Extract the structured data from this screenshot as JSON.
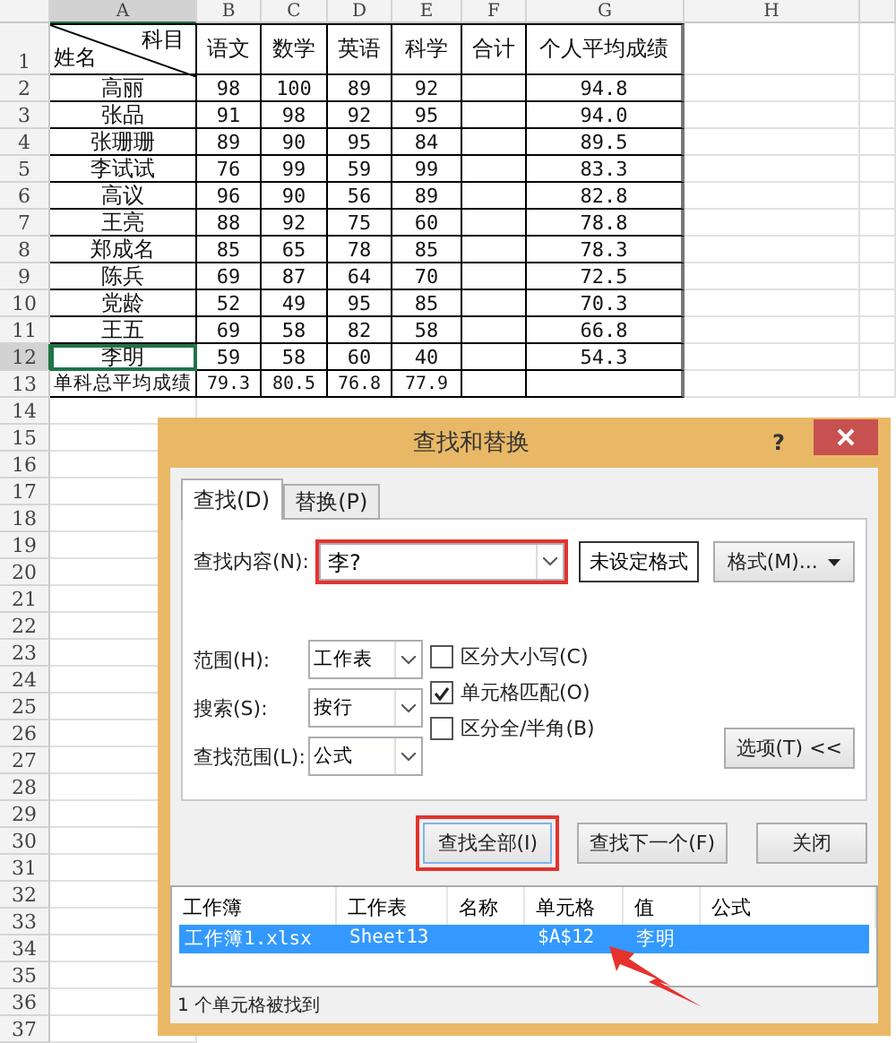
{
  "sheet": {
    "columns": [
      "A",
      "B",
      "C",
      "D",
      "E",
      "F",
      "G",
      "H"
    ],
    "header": {
      "row": "1",
      "subject": "科目",
      "name": "姓名",
      "cells": [
        "语文",
        "数学",
        "英语",
        "科学",
        "合计",
        "个人平均成绩"
      ]
    },
    "rows": [
      {
        "row": "2",
        "name": "高丽",
        "scores": [
          "98",
          "100",
          "89",
          "92"
        ],
        "avg": "94.8",
        "selected": false
      },
      {
        "row": "3",
        "name": "张品",
        "scores": [
          "91",
          "98",
          "92",
          "95"
        ],
        "avg": "94.0",
        "selected": false
      },
      {
        "row": "4",
        "name": "张珊珊",
        "scores": [
          "89",
          "90",
          "95",
          "84"
        ],
        "avg": "89.5",
        "selected": false
      },
      {
        "row": "5",
        "name": "李试试",
        "scores": [
          "76",
          "99",
          "59",
          "99"
        ],
        "avg": "83.3",
        "selected": false
      },
      {
        "row": "6",
        "name": "高议",
        "scores": [
          "96",
          "90",
          "56",
          "89"
        ],
        "avg": "82.8",
        "selected": false
      },
      {
        "row": "7",
        "name": "王亮",
        "scores": [
          "88",
          "92",
          "75",
          "60"
        ],
        "avg": "78.8",
        "selected": false
      },
      {
        "row": "8",
        "name": "郑成名",
        "scores": [
          "85",
          "65",
          "78",
          "85"
        ],
        "avg": "78.3",
        "selected": false
      },
      {
        "row": "9",
        "name": "陈兵",
        "scores": [
          "69",
          "87",
          "64",
          "70"
        ],
        "avg": "72.5",
        "selected": false
      },
      {
        "row": "10",
        "name": "党龄",
        "scores": [
          "52",
          "49",
          "95",
          "85"
        ],
        "avg": "70.3",
        "selected": false
      },
      {
        "row": "11",
        "name": "王五",
        "scores": [
          "69",
          "58",
          "82",
          "58"
        ],
        "avg": "66.8",
        "selected": false
      },
      {
        "row": "12",
        "name": "李明",
        "scores": [
          "59",
          "58",
          "60",
          "40"
        ],
        "avg": "54.3",
        "selected": true
      }
    ],
    "summary": {
      "row": "13",
      "label": "单科总平均成绩",
      "values": [
        "79.3",
        "80.5",
        "76.8",
        "77.9"
      ]
    },
    "more_rows": [
      "14",
      "15",
      "16",
      "17",
      "18",
      "19",
      "20",
      "21",
      "22",
      "23",
      "24",
      "25",
      "26",
      "27",
      "28",
      "29",
      "30",
      "31",
      "32",
      "33",
      "34",
      "35",
      "36",
      "37"
    ]
  },
  "dialog": {
    "title": "查找和替换",
    "help": "?",
    "tabs": [
      {
        "label": "查找(D)",
        "selected": true
      },
      {
        "label": "替换(P)",
        "selected": false
      }
    ],
    "find_what": {
      "label": "查找内容(N):",
      "value": "李?",
      "highlighted": true
    },
    "format_status": "未设定格式",
    "format_button": "格式(M)...",
    "selects": [
      {
        "label": "范围(H):",
        "value": "工作表"
      },
      {
        "label": "搜索(S):",
        "value": "按行"
      },
      {
        "label": "查找范围(L):",
        "value": "公式"
      }
    ],
    "checkboxes": [
      {
        "label": "区分大小写(C)",
        "checked": false
      },
      {
        "label": "单元格匹配(O)",
        "checked": true
      },
      {
        "label": "区分全/半角(B)",
        "checked": false
      }
    ],
    "options_button": "选项(T) <<",
    "buttons": [
      {
        "label": "查找全部(I)",
        "highlighted": true
      },
      {
        "label": "查找下一个(F)",
        "highlighted": false
      },
      {
        "label": "关闭",
        "highlighted": false
      }
    ],
    "results": {
      "columns": [
        "工作簿",
        "工作表",
        "名称",
        "单元格",
        "值",
        "公式"
      ],
      "rows": [
        {
          "workbook": "工作簿1.xlsx",
          "sheet": "Sheet13",
          "cell": "$A$12",
          "value": "李明",
          "selected": true
        }
      ]
    },
    "status": "1 个单元格被找到"
  }
}
